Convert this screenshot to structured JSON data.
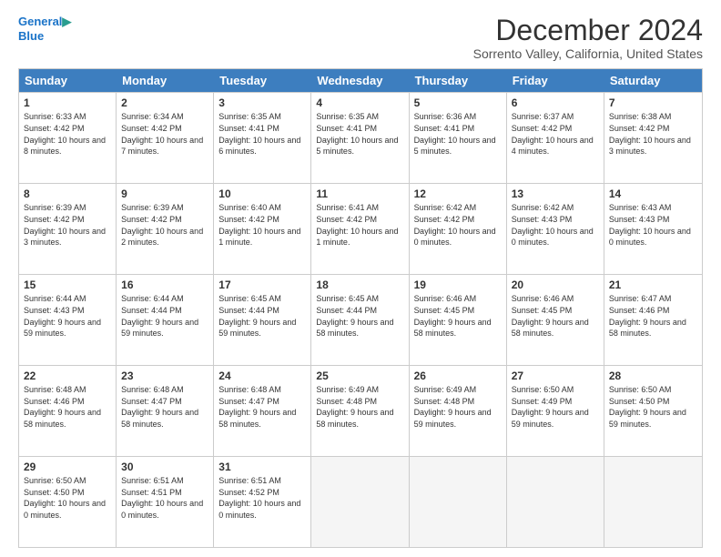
{
  "logo": {
    "line1": "General",
    "line2": "Blue"
  },
  "title": "December 2024",
  "location": "Sorrento Valley, California, United States",
  "days": [
    "Sunday",
    "Monday",
    "Tuesday",
    "Wednesday",
    "Thursday",
    "Friday",
    "Saturday"
  ],
  "weeks": [
    [
      {
        "day": 1,
        "sunrise": "6:33 AM",
        "sunset": "4:42 PM",
        "daylight": "10 hours and 8 minutes."
      },
      {
        "day": 2,
        "sunrise": "6:34 AM",
        "sunset": "4:42 PM",
        "daylight": "10 hours and 7 minutes."
      },
      {
        "day": 3,
        "sunrise": "6:35 AM",
        "sunset": "4:41 PM",
        "daylight": "10 hours and 6 minutes."
      },
      {
        "day": 4,
        "sunrise": "6:35 AM",
        "sunset": "4:41 PM",
        "daylight": "10 hours and 5 minutes."
      },
      {
        "day": 5,
        "sunrise": "6:36 AM",
        "sunset": "4:41 PM",
        "daylight": "10 hours and 5 minutes."
      },
      {
        "day": 6,
        "sunrise": "6:37 AM",
        "sunset": "4:42 PM",
        "daylight": "10 hours and 4 minutes."
      },
      {
        "day": 7,
        "sunrise": "6:38 AM",
        "sunset": "4:42 PM",
        "daylight": "10 hours and 3 minutes."
      }
    ],
    [
      {
        "day": 8,
        "sunrise": "6:39 AM",
        "sunset": "4:42 PM",
        "daylight": "10 hours and 3 minutes."
      },
      {
        "day": 9,
        "sunrise": "6:39 AM",
        "sunset": "4:42 PM",
        "daylight": "10 hours and 2 minutes."
      },
      {
        "day": 10,
        "sunrise": "6:40 AM",
        "sunset": "4:42 PM",
        "daylight": "10 hours and 1 minute."
      },
      {
        "day": 11,
        "sunrise": "6:41 AM",
        "sunset": "4:42 PM",
        "daylight": "10 hours and 1 minute."
      },
      {
        "day": 12,
        "sunrise": "6:42 AM",
        "sunset": "4:42 PM",
        "daylight": "10 hours and 0 minutes."
      },
      {
        "day": 13,
        "sunrise": "6:42 AM",
        "sunset": "4:43 PM",
        "daylight": "10 hours and 0 minutes."
      },
      {
        "day": 14,
        "sunrise": "6:43 AM",
        "sunset": "4:43 PM",
        "daylight": "10 hours and 0 minutes."
      }
    ],
    [
      {
        "day": 15,
        "sunrise": "6:44 AM",
        "sunset": "4:43 PM",
        "daylight": "9 hours and 59 minutes."
      },
      {
        "day": 16,
        "sunrise": "6:44 AM",
        "sunset": "4:44 PM",
        "daylight": "9 hours and 59 minutes."
      },
      {
        "day": 17,
        "sunrise": "6:45 AM",
        "sunset": "4:44 PM",
        "daylight": "9 hours and 59 minutes."
      },
      {
        "day": 18,
        "sunrise": "6:45 AM",
        "sunset": "4:44 PM",
        "daylight": "9 hours and 58 minutes."
      },
      {
        "day": 19,
        "sunrise": "6:46 AM",
        "sunset": "4:45 PM",
        "daylight": "9 hours and 58 minutes."
      },
      {
        "day": 20,
        "sunrise": "6:46 AM",
        "sunset": "4:45 PM",
        "daylight": "9 hours and 58 minutes."
      },
      {
        "day": 21,
        "sunrise": "6:47 AM",
        "sunset": "4:46 PM",
        "daylight": "9 hours and 58 minutes."
      }
    ],
    [
      {
        "day": 22,
        "sunrise": "6:48 AM",
        "sunset": "4:46 PM",
        "daylight": "9 hours and 58 minutes."
      },
      {
        "day": 23,
        "sunrise": "6:48 AM",
        "sunset": "4:47 PM",
        "daylight": "9 hours and 58 minutes."
      },
      {
        "day": 24,
        "sunrise": "6:48 AM",
        "sunset": "4:47 PM",
        "daylight": "9 hours and 58 minutes."
      },
      {
        "day": 25,
        "sunrise": "6:49 AM",
        "sunset": "4:48 PM",
        "daylight": "9 hours and 58 minutes."
      },
      {
        "day": 26,
        "sunrise": "6:49 AM",
        "sunset": "4:48 PM",
        "daylight": "9 hours and 59 minutes."
      },
      {
        "day": 27,
        "sunrise": "6:50 AM",
        "sunset": "4:49 PM",
        "daylight": "9 hours and 59 minutes."
      },
      {
        "day": 28,
        "sunrise": "6:50 AM",
        "sunset": "4:50 PM",
        "daylight": "9 hours and 59 minutes."
      }
    ],
    [
      {
        "day": 29,
        "sunrise": "6:50 AM",
        "sunset": "4:50 PM",
        "daylight": "10 hours and 0 minutes."
      },
      {
        "day": 30,
        "sunrise": "6:51 AM",
        "sunset": "4:51 PM",
        "daylight": "10 hours and 0 minutes."
      },
      {
        "day": 31,
        "sunrise": "6:51 AM",
        "sunset": "4:52 PM",
        "daylight": "10 hours and 0 minutes."
      },
      null,
      null,
      null,
      null
    ]
  ],
  "labels": {
    "sunrise": "Sunrise:",
    "sunset": "Sunset:",
    "daylight": "Daylight:"
  }
}
